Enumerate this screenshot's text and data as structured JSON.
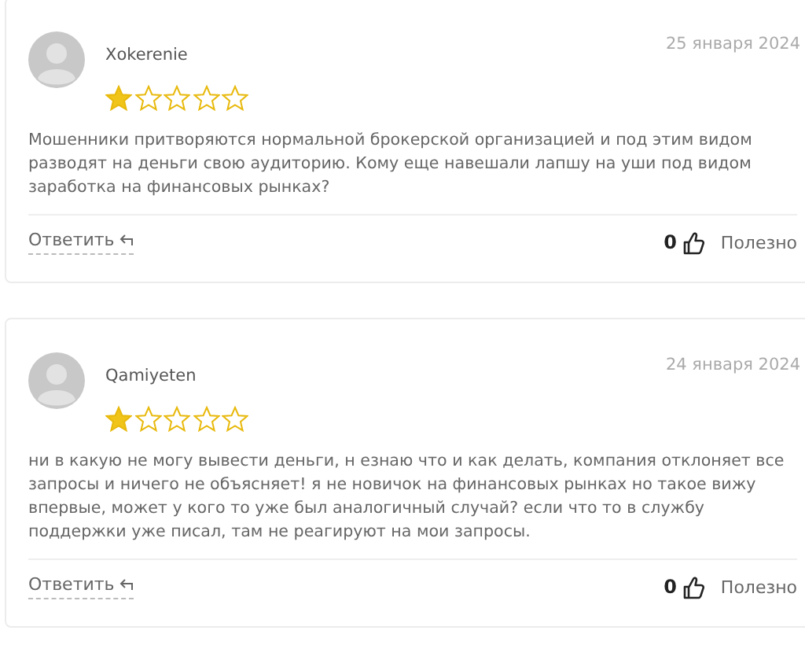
{
  "reviews": [
    {
      "author": "Xokerenie",
      "date": "25 января 2024",
      "stars": 1,
      "text": "Мошенники притворяются нормальной брокерской организацией и под этим видом разводят на деньги свою аудиторию. Кому еще навешали лапшу на уши под видом заработка на финансовых рынках?",
      "reply": "Ответить",
      "likes": "0",
      "useful": "Полезно"
    },
    {
      "author": "Qamiyeten",
      "date": "24 января 2024",
      "stars": 1,
      "text": "ни в какую не могу вывести деньги, н езнаю что и как делать, компания отклоняет все запросы и ничего не объясняет! я не новичок на финансовых рынках но такое вижу впервые, может у кого то уже был аналогичный случай? если что то в службу поддержки уже писал, там не реагируют на мои запросы.",
      "reply": "Ответить",
      "likes": "0",
      "useful": "Полезно"
    }
  ]
}
